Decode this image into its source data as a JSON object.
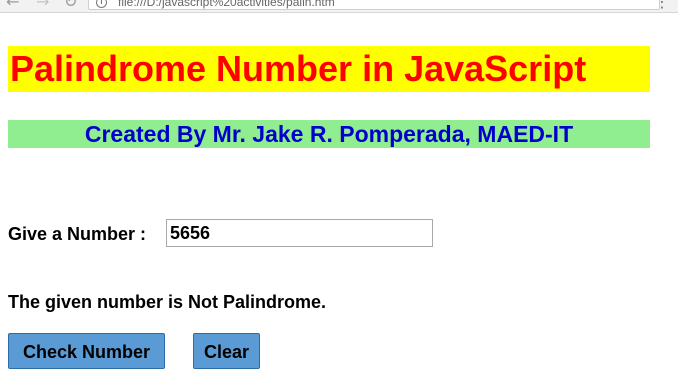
{
  "browser": {
    "back_icon": "arrow-left-icon",
    "forward_icon": "arrow-right-icon",
    "reload_icon": "reload-icon",
    "info_icon": "info-icon",
    "address": "file:///D:/javascript%20activities/palin.htm"
  },
  "header": {
    "title": "Palindrome Number in JavaScript",
    "title_color": "#ff0000",
    "title_background": "#ffff00",
    "credit": "Created By Mr. Jake R. Pomperada, MAED-IT",
    "credit_color": "#0000cd",
    "credit_background": "#90ee90"
  },
  "form": {
    "number_label": "Give a Number :",
    "number_value": "5656",
    "result": "The given number is Not Palindrome.",
    "check_button_label": "Check Number",
    "clear_button_label": "Clear",
    "button_color": "#5a9bd5"
  }
}
